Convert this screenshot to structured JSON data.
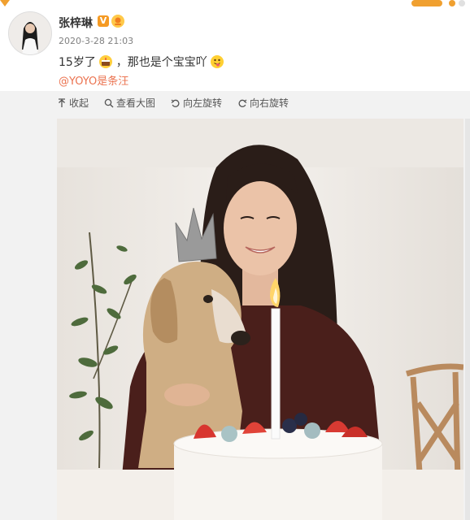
{
  "post": {
    "author": "张梓琳",
    "verified_badge": "V",
    "date": "2020-3-28 21:03",
    "content_text_1": "15岁了",
    "content_text_2": "，那也是个宝宝吖",
    "mention": "@YOYO是条汪",
    "icons": [
      "cake-emoji-icon",
      "tongue-face-emoji-icon",
      "verified-icon",
      "fan-badge-icon"
    ]
  },
  "toolbar": {
    "collapse": "收起",
    "view_large": "查看大图",
    "rotate_left": "向左旋转",
    "rotate_right": "向右旋转",
    "icons": [
      "collapse-icon",
      "zoom-icon",
      "rotate-left-icon",
      "rotate-right-icon"
    ]
  },
  "colors": {
    "mention": "#eb7350",
    "verified": "#f59a23",
    "background": "#f2f2f2"
  }
}
